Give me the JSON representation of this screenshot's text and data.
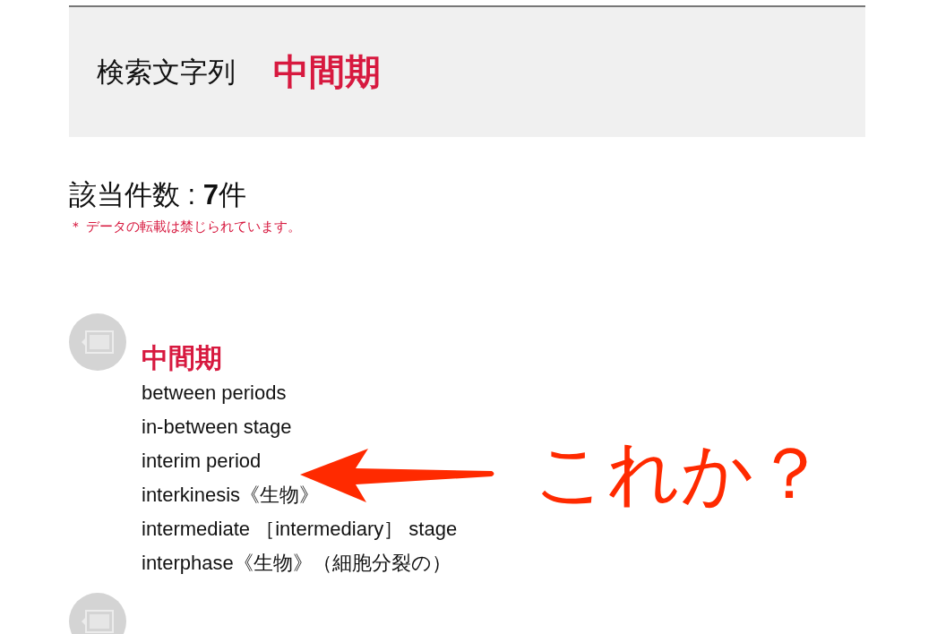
{
  "search": {
    "label": "検索文字列",
    "term": "中間期"
  },
  "result_count": "該当件数 : **7**件",
  "notice": "＊ データの転載は禁じられています。",
  "entries": [
    {
      "term": "中間期",
      "translations": [
        "between periods",
        "in-between stage",
        "interim period",
        "interkinesis《生物》",
        "intermediate ［intermediary］ stage",
        "interphase《生物》（細胞分裂の）"
      ]
    }
  ],
  "annotation": {
    "text": "これか？"
  }
}
